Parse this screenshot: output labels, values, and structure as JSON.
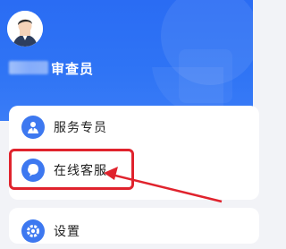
{
  "header": {
    "role_name_visible": "审查员"
  },
  "menu": {
    "items": [
      {
        "label": "服务专员",
        "icon": "user-tie-icon"
      },
      {
        "label": "在线客服",
        "icon": "chat-bubble-icon"
      }
    ],
    "settings": {
      "label": "设置",
      "icon": "gear-icon"
    }
  },
  "annotation": {
    "color": "#e0232d",
    "highlighted_item": "在线客服"
  },
  "colors": {
    "header_blue": "#2f74f5",
    "icon_blue": "#3d78f0",
    "background": "#f2f3f7"
  }
}
